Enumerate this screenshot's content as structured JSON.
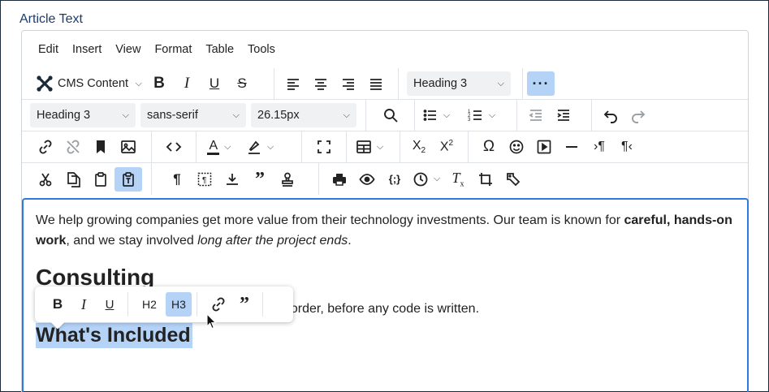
{
  "field_label": "Article Text",
  "menubar": [
    "Edit",
    "Insert",
    "View",
    "Format",
    "Table",
    "Tools"
  ],
  "toolbar": {
    "cms_content_label": "CMS Content",
    "block_format_row1": "Heading 3",
    "block_format_row2": "Heading 3",
    "font_family": "sans-serif",
    "font_size": "26.15px"
  },
  "content": {
    "para1_pre": "We help growing companies get more value from their technology investments. Our team is known for ",
    "para1_bold": "careful, hands-on work",
    "para1_mid": ", and we stay involved ",
    "para1_italic": "long after the project ends",
    "para1_end": ".",
    "heading2": "Consulting",
    "para2_visible": "t order, before any code is written.",
    "heading3_selected": "What's Included"
  },
  "quick_toolbar": {
    "h2_label": "H2",
    "h3_label": "H3"
  },
  "colors": {
    "accent": "#2c7be5",
    "active_bg": "#b4d3f7",
    "label": "#1c3b6e"
  }
}
